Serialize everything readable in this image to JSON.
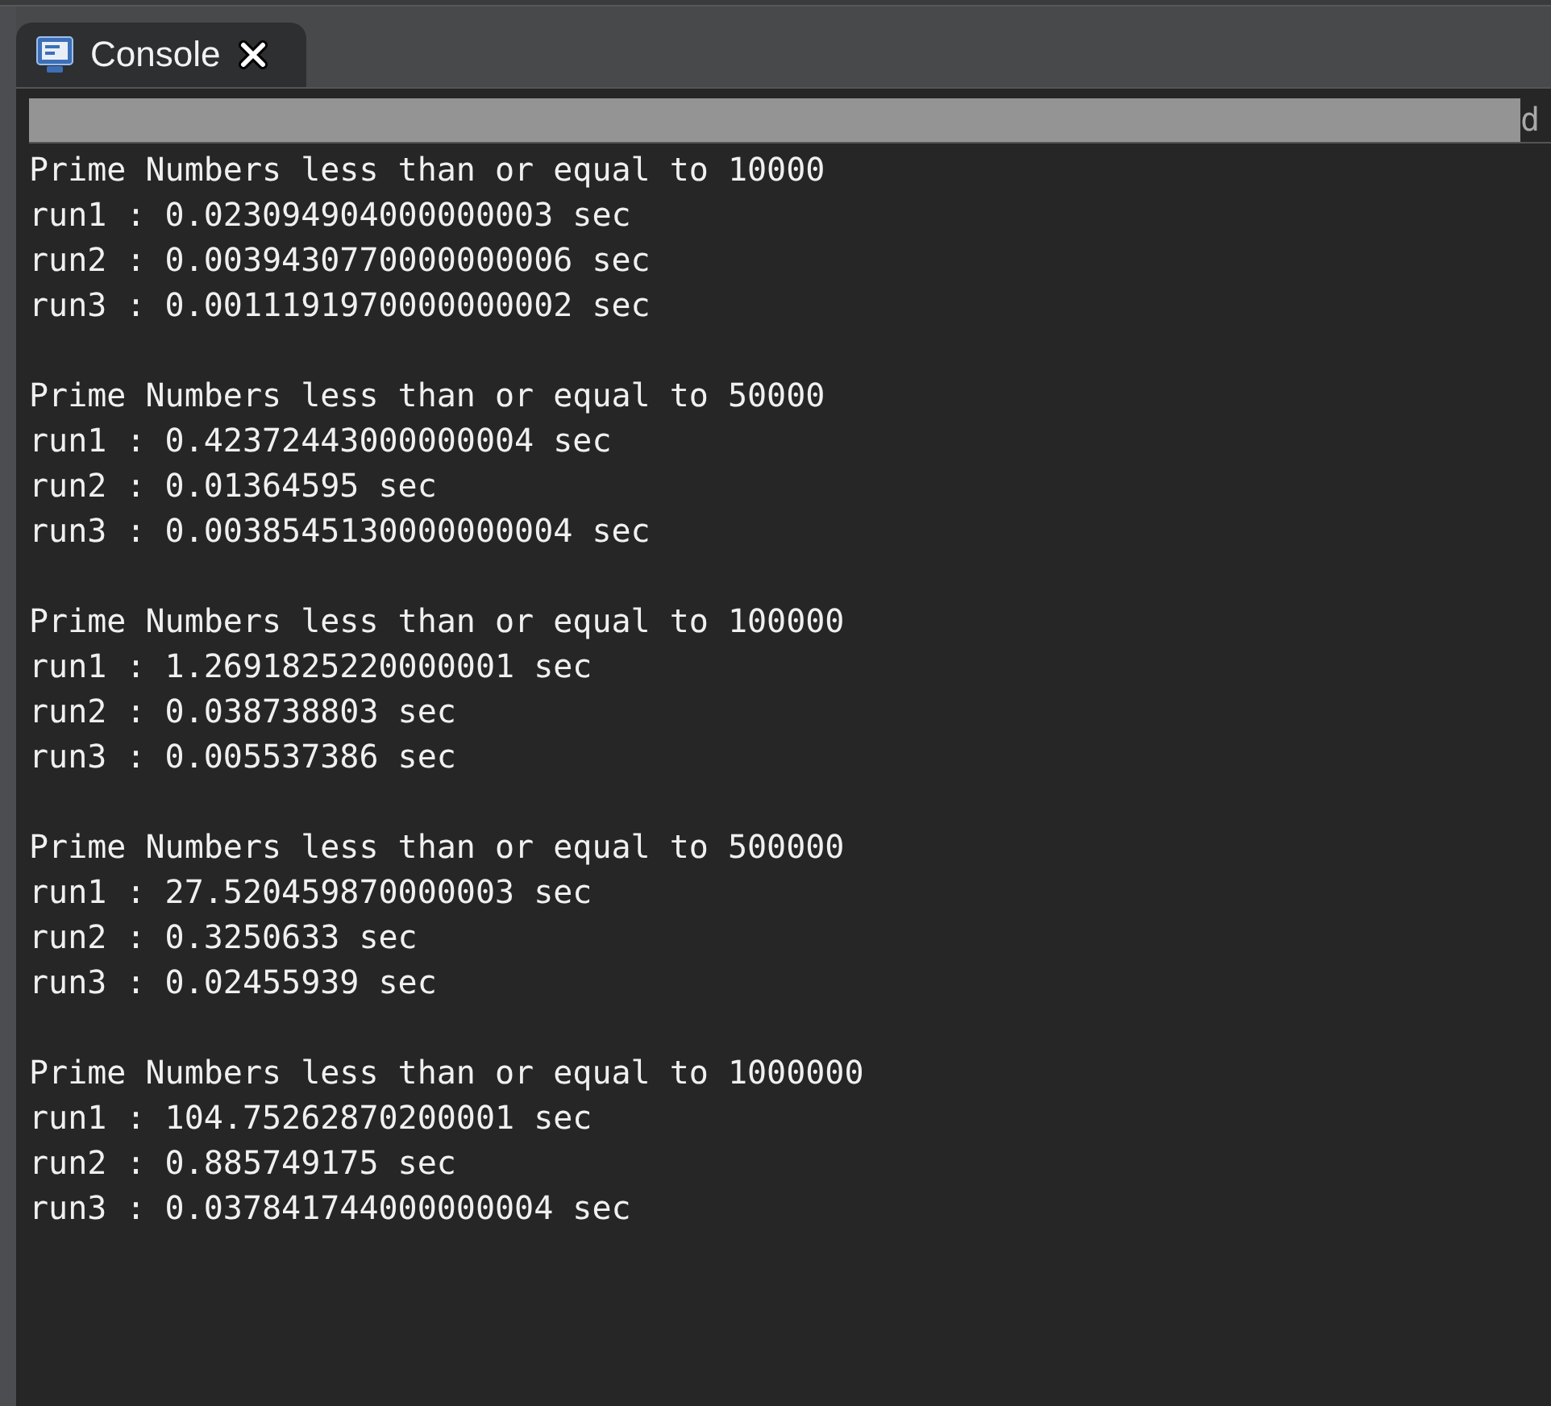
{
  "tab": {
    "title": "Console"
  },
  "path_bar": {
    "text": "d"
  },
  "groups": [
    {
      "heading": "Prime Numbers less than or equal to 10000",
      "runs": [
        "run1 : 0.023094904000000003 sec",
        "run2 : 0.0039430770000000006 sec",
        "run3 : 0.0011191970000000002 sec"
      ]
    },
    {
      "heading": "Prime Numbers less than or equal to 50000",
      "runs": [
        "run1 : 0.42372443000000004 sec",
        "run2 : 0.01364595 sec",
        "run3 : 0.0038545130000000004 sec"
      ]
    },
    {
      "heading": "Prime Numbers less than or equal to 100000",
      "runs": [
        "run1 : 1.2691825220000001 sec",
        "run2 : 0.038738803 sec",
        "run3 : 0.005537386 sec"
      ]
    },
    {
      "heading": "Prime Numbers less than or equal to 500000",
      "runs": [
        "run1 : 27.520459870000003 sec",
        "run2 : 0.3250633 sec",
        "run3 : 0.02455939 sec"
      ]
    },
    {
      "heading": "Prime Numbers less than or equal to 1000000",
      "runs": [
        "run1 : 104.75262870200001 sec",
        "run2 : 0.885749175 sec",
        "run3 : 0.037841744000000004 sec"
      ]
    }
  ]
}
